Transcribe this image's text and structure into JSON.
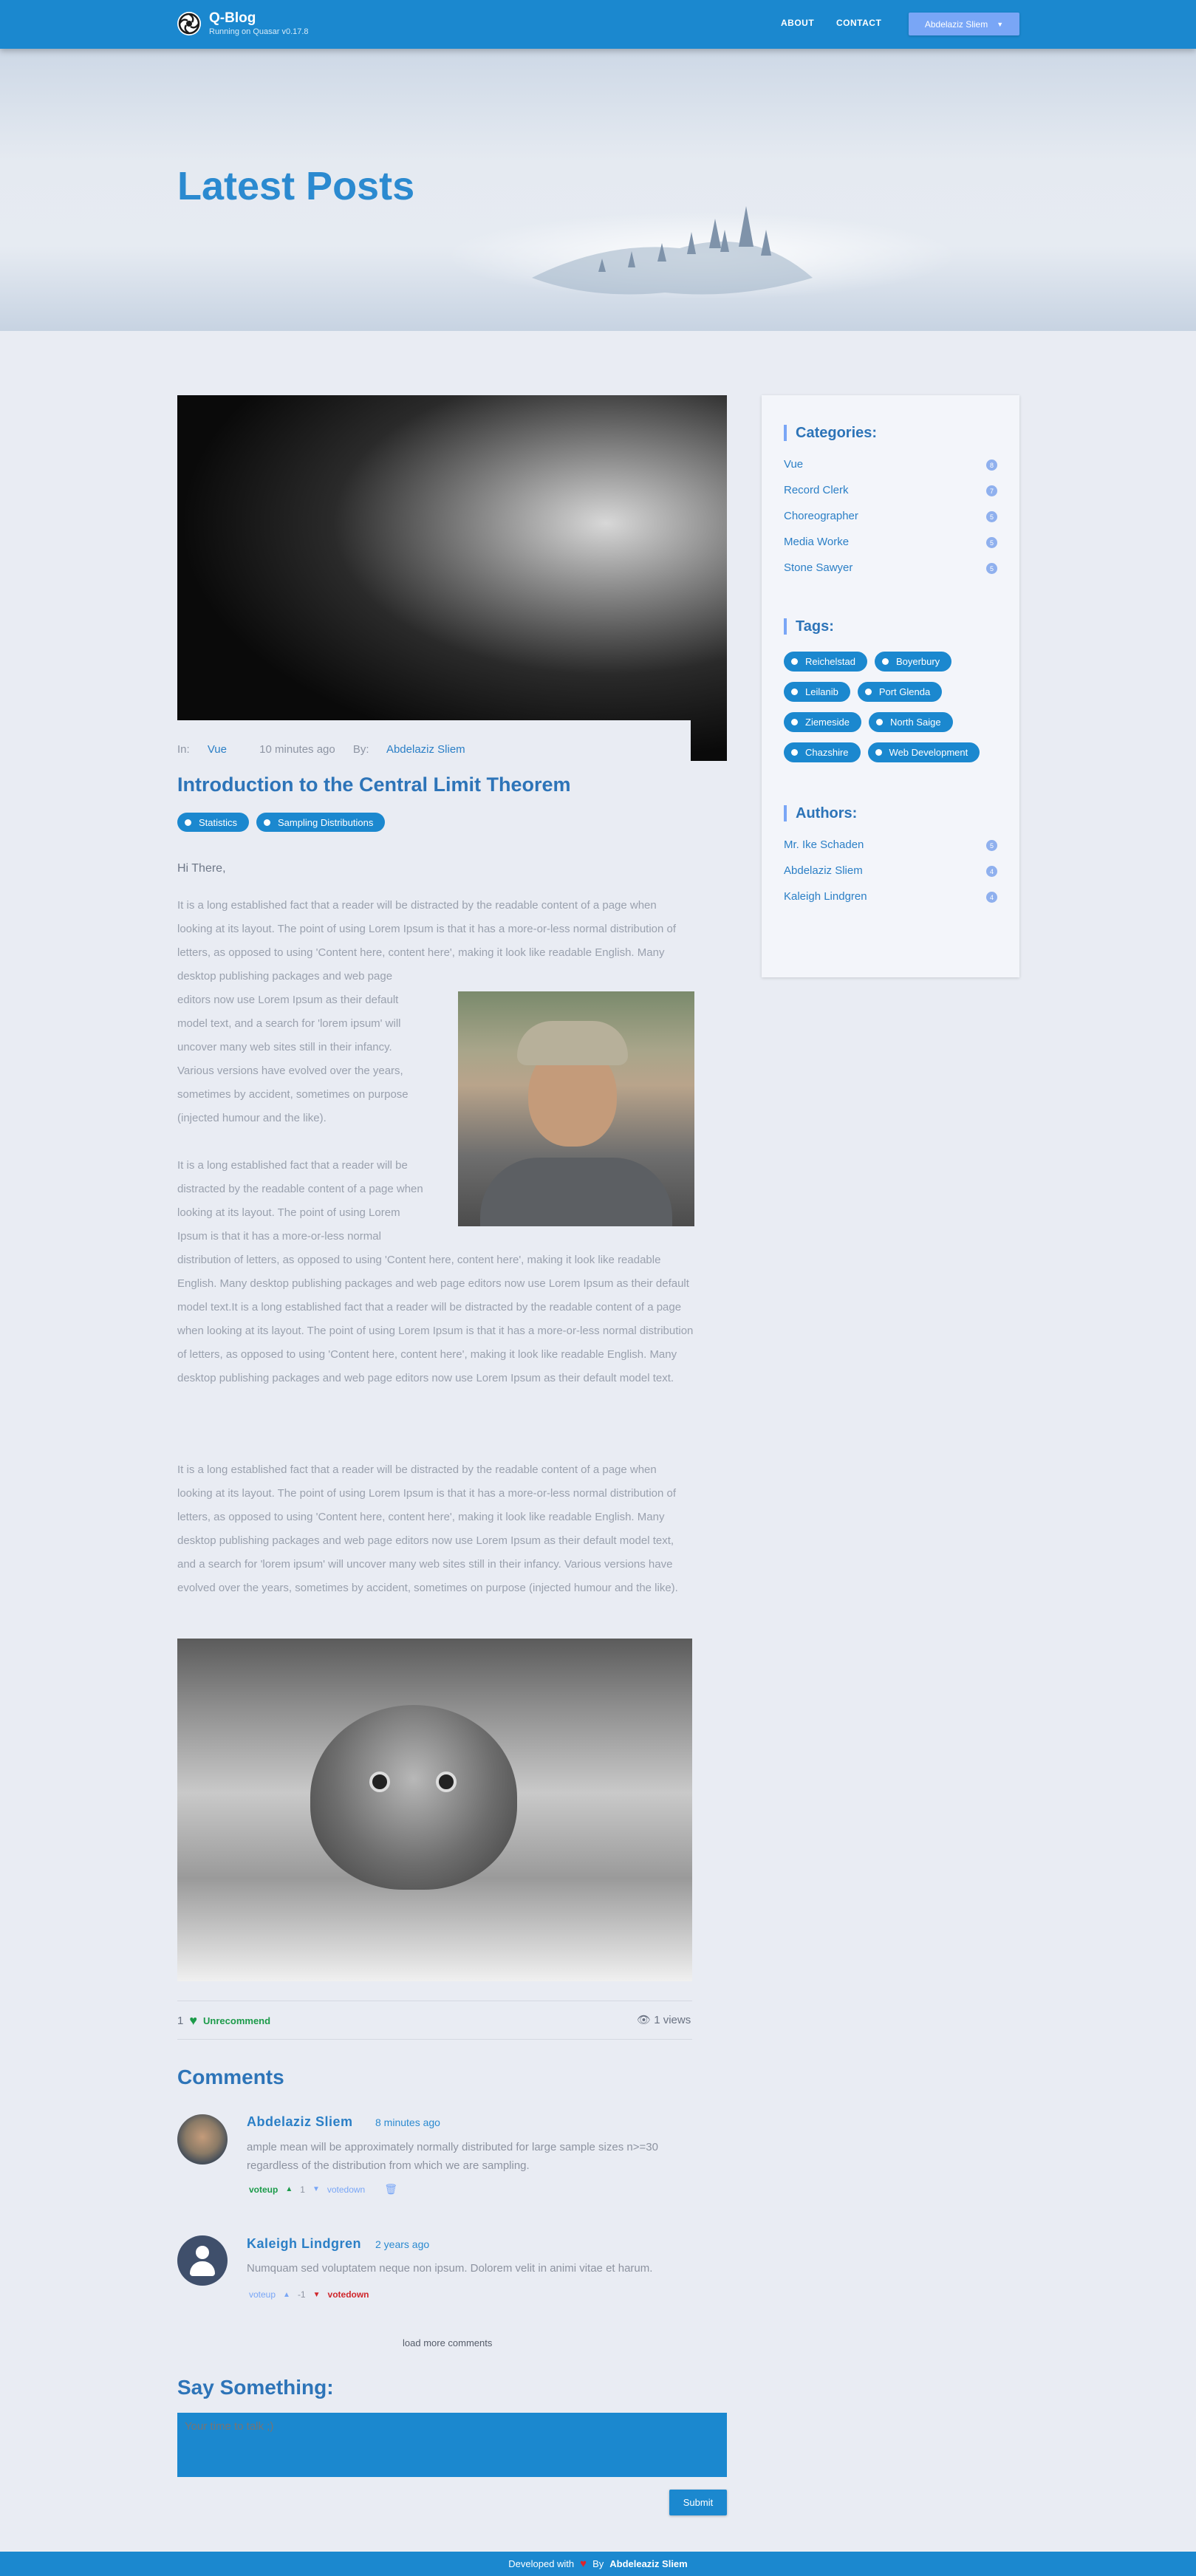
{
  "header": {
    "brand_title": "Q-Blog",
    "brand_subtitle": "Running on Quasar v0.17.8",
    "nav": [
      "ABOUT",
      "CONTACT"
    ],
    "user_button": "Abdelaziz Sliem",
    "colors": {
      "primary": "#1b88cf",
      "accent": "#79a6f6"
    }
  },
  "hero": {
    "title": "Latest Posts"
  },
  "post": {
    "meta_in_label": "In:",
    "category": "Vue",
    "time": "10 minutes ago",
    "by_label": "By:",
    "author": "Abdelaziz Sliem",
    "title": "Introduction to the Central Limit Theorem",
    "tags": [
      "Statistics",
      "Sampling Distributions"
    ],
    "greeting": "Hi There,",
    "paragraph1": "It is a long established fact that a reader will be distracted by the readable content of a page when looking at its layout. The point of using Lorem Ipsum is that it has a more-or-less normal distribution of letters, as opposed to using 'Content here, content here', making it look like readable English. Many desktop publishing packages and web page editors now use Lorem Ipsum as their default model text, and a search for 'lorem ipsum' will uncover many web sites still in their infancy. Various versions have evolved over the years, sometimes by accident, sometimes on purpose (injected humour and the like).",
    "paragraph2": "It is a long established fact that a reader will be distracted by the readable content of a page when looking at its layout. The point of using Lorem Ipsum is that it has a more-or-less normal distribution of letters, as opposed to using 'Content here, content here', making it look like readable English. Many desktop publishing packages and web page editors now use Lorem Ipsum as their default model text.It is a long established fact that a reader will be distracted by the readable content of a page when looking at its layout. The point of using Lorem Ipsum is that it has a more-or-less normal distribution of letters, as opposed to using 'Content here, content here', making it look like readable English. Many desktop publishing packages and web page editors now use Lorem Ipsum as their default model text.",
    "paragraph3": "It is a long established fact that a reader will be distracted by the readable content of a page when looking at its layout. The point of using Lorem Ipsum is that it has a more-or-less normal distribution of letters, as opposed to using 'Content here, content here', making it look like readable English. Many desktop publishing packages and web page editors now use Lorem Ipsum as their default model text, and a search for 'lorem ipsum' will uncover many web sites still in their infancy. Various versions have evolved over the years, sometimes by accident, sometimes on purpose (injected humour and the like).",
    "likes_count": "1",
    "like_action": "Unrecommend",
    "views": "1 views"
  },
  "comments": {
    "heading": "Comments",
    "items": [
      {
        "name": "Abdelaziz Sliem",
        "time": "8 minutes ago",
        "text": "ample mean will be approximately normally distributed for large sample sizes n>=30 regardless of the distribution from which we are sampling.",
        "voteup": "voteup",
        "count": "1",
        "votedown": "votedown"
      },
      {
        "name": "Kaleigh Lindgren",
        "time": "2 years ago",
        "text": "Numquam sed voluptatem neque non ipsum. Dolorem velit in animi vitae et harum.",
        "voteup": "voteup",
        "count": "-1",
        "votedown": "votedown"
      }
    ],
    "load_more": "load more comments"
  },
  "say_something": {
    "heading": "Say Something:",
    "placeholder": "Your time to talk ;)",
    "submit": "Submit"
  },
  "sidebar": {
    "categories_heading": "Categories:",
    "categories": [
      {
        "label": "Vue",
        "count": "8"
      },
      {
        "label": "Record Clerk",
        "count": "7"
      },
      {
        "label": "Choreographer",
        "count": "5"
      },
      {
        "label": "Media Worke",
        "count": "5"
      },
      {
        "label": "Stone Sawyer",
        "count": "5"
      }
    ],
    "tags_heading": "Tags:",
    "tags": [
      "Reichelstad",
      "Boyerbury",
      "Leilanib",
      "Port Glenda",
      "Ziemeside",
      "North Saige",
      "Chazshire",
      "Web Development"
    ],
    "authors_heading": "Authors:",
    "authors": [
      {
        "label": "Mr. Ike Schaden",
        "count": "5"
      },
      {
        "label": "Abdelaziz Sliem",
        "count": "4"
      },
      {
        "label": "Kaleigh Lindgren",
        "count": "4"
      }
    ]
  },
  "footer": {
    "developed_with": "Developed with",
    "by_label": "By",
    "author": "Abdeleaziz Sliem"
  }
}
